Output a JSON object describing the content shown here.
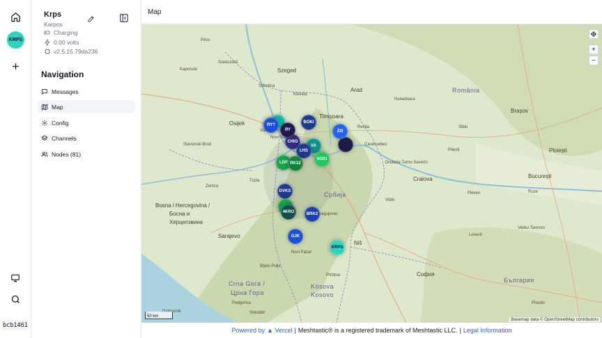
{
  "rail": {
    "avatar_label": "KRPS",
    "version": "bcb1461"
  },
  "sidebar": {
    "node_short_name": "Krps",
    "node_long_name": "Karpos",
    "battery_status": "Charging",
    "voltage": "0.00 volts",
    "firmware": "v2.5.15.79da236",
    "nav_heading": "Navigation",
    "nav_items": [
      {
        "label": "Messages",
        "icon": "message-icon"
      },
      {
        "label": "Map",
        "icon": "map-icon"
      },
      {
        "label": "Config",
        "icon": "gear-icon"
      },
      {
        "label": "Channels",
        "icon": "layers-icon"
      },
      {
        "label": "Nodes (81)",
        "icon": "users-icon"
      }
    ]
  },
  "main": {
    "title": "Map"
  },
  "map": {
    "places": [
      {
        "name": "Pécs"
      },
      {
        "name": "Szekszárd"
      },
      {
        "name": "Szeged"
      },
      {
        "name": "Kaposvár"
      },
      {
        "name": "Subotica"
      },
      {
        "name": "Osijek"
      },
      {
        "name": "Kikinda"
      },
      {
        "name": "Arad"
      },
      {
        "name": "Timișoara"
      },
      {
        "name": "România"
      },
      {
        "name": "Hunedoara"
      },
      {
        "name": "Brașov"
      },
      {
        "name": "Sibiu"
      },
      {
        "name": "Slavonski Brod"
      },
      {
        "name": "Vukovar"
      },
      {
        "name": "Novi Sad"
      },
      {
        "name": "Resita"
      },
      {
        "name": "Caransebes"
      },
      {
        "name": "Pitești"
      },
      {
        "name": "Ploiești"
      },
      {
        "name": "București"
      },
      {
        "name": "Craiova"
      },
      {
        "name": "Drobeta-Turnu Severin"
      },
      {
        "name": "Bosna i Hercegovina /"
      },
      {
        "name": "Босна и"
      },
      {
        "name": "Херцеговина"
      },
      {
        "name": "Tuzla"
      },
      {
        "name": "Zenica"
      },
      {
        "name": "Sarajevo"
      },
      {
        "name": "Србија"
      },
      {
        "name": "Kragujevac"
      },
      {
        "name": "Niš"
      },
      {
        "name": "Vidin"
      },
      {
        "name": "Pleven"
      },
      {
        "name": "Ruse"
      },
      {
        "name": "Crna Gora /"
      },
      {
        "name": "Црна Гора"
      },
      {
        "name": "Podgorica"
      },
      {
        "name": "Kosova"
      },
      {
        "name": "Kosovo"
      },
      {
        "name": "Priština"
      },
      {
        "name": "София"
      },
      {
        "name": "България"
      },
      {
        "name": "Shkodër"
      },
      {
        "name": "Bijelo Polje"
      },
      {
        "name": "Novi Pazar"
      },
      {
        "name": "Lovech"
      },
      {
        "name": "Veliko Tarnovo"
      },
      {
        "name": "Plovdiv"
      },
      {
        "name": "Dubrovnik"
      }
    ],
    "nodes": [
      {
        "label": "RY?",
        "color": "#1d4ed8"
      },
      {
        "label": "",
        "color": "#14b8a6"
      },
      {
        "label": "RY",
        "color": "#1e1b4b"
      },
      {
        "label": "BOKI",
        "color": "#1e3a8a"
      },
      {
        "label": "ZI3",
        "color": "#2563eb"
      },
      {
        "label": "",
        "color": "#1e1b4b"
      },
      {
        "label": "CHIO",
        "color": "#312e81"
      },
      {
        "label": "VA",
        "color": "#0d9488"
      },
      {
        "label": "LHS",
        "color": "#1e3a8a"
      },
      {
        "label": "LDP",
        "color": "#16a34a"
      },
      {
        "label": "RK12",
        "color": "#15803d"
      },
      {
        "label": "SO01",
        "color": "#22c55e"
      },
      {
        "label": "DVKS",
        "color": "#1e3a8a"
      },
      {
        "label": "",
        "color": "#16a34a"
      },
      {
        "label": "4KRO",
        "color": "#134e4a"
      },
      {
        "label": "BRK2",
        "color": "#1e40af"
      },
      {
        "label": "GJK",
        "color": "#1d4ed8"
      },
      {
        "label": "KRPS",
        "color": "#2dd4bf"
      }
    ],
    "scale_label": "50 km",
    "attribution": "Basemap data © OpenStreetMap contributors",
    "controls": {
      "locate": "locate-icon",
      "zoom_in": "+",
      "zoom_out": "−"
    }
  },
  "footer": {
    "powered_by": "Powered by",
    "vercel": "▲ Vercel",
    "separator1": "|",
    "trademark": "Meshtastic® is a registered trademark of Meshtastic LLC.",
    "separator2": "|",
    "legal": "Legal Information"
  }
}
